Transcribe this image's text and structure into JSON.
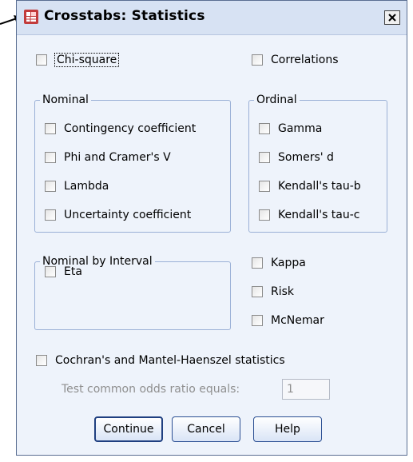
{
  "dialog": {
    "title": "Crosstabs: Statistics",
    "accent": "#d7e2f3",
    "close_label": "X"
  },
  "options": {
    "chi_square": "Chi-square",
    "correlations": "Correlations",
    "cochran": "Cochran's and Mantel-Haenszel statistics"
  },
  "nominal": {
    "legend": "Nominal",
    "items": [
      "Contingency coefficient",
      "Phi and Cramer's V",
      "Lambda",
      "Uncertainty coefficient"
    ]
  },
  "ordinal": {
    "legend": "Ordinal",
    "items": [
      "Gamma",
      "Somers' d",
      "Kendall's tau-b",
      "Kendall's tau-c"
    ]
  },
  "nominal_by_interval": {
    "legend": "Nominal by Interval",
    "items": [
      "Eta"
    ]
  },
  "other": {
    "items": [
      "Kappa",
      "Risk",
      "McNemar"
    ]
  },
  "odds_ratio": {
    "label": "Test common odds ratio equals:",
    "value": "1"
  },
  "buttons": {
    "continue": "Continue",
    "cancel": "Cancel",
    "help": "Help"
  }
}
